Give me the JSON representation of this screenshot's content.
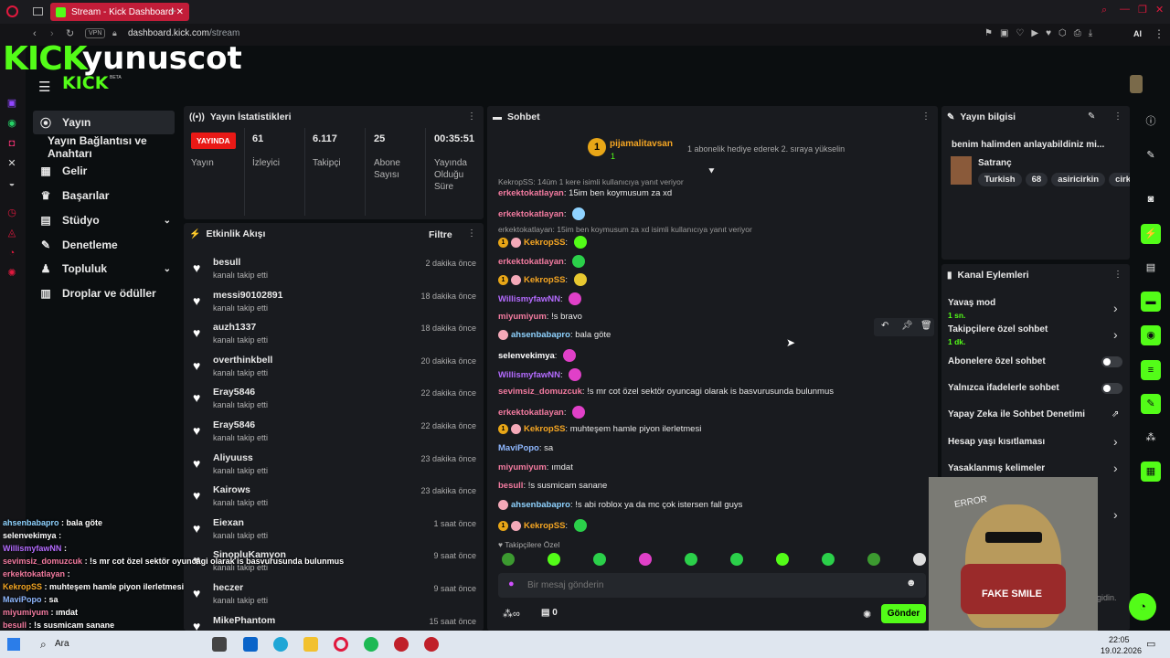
{
  "browser": {
    "tab_title": "Stream - Kick Dashboard",
    "url_domain": "dashboard.kick.com",
    "url_path": "/stream",
    "vpn": "VPN",
    "ai_label": "AI"
  },
  "brand": {
    "overlay_logo": "KICK",
    "overlay_name": "yunuscot",
    "logo": "KICK",
    "beta": "BETA"
  },
  "nav": {
    "items": [
      {
        "label": "Yayın",
        "icon": "broadcast-icon"
      },
      {
        "label": "Yayın Bağlantısı ve Anahtarı",
        "icon": ""
      },
      {
        "label": "Gelir",
        "icon": "chart-icon"
      },
      {
        "label": "Başarılar",
        "icon": "trophy-icon"
      },
      {
        "label": "Stüdyo",
        "icon": "studio-icon"
      },
      {
        "label": "Denetleme",
        "icon": "wrench-icon"
      },
      {
        "label": "Topluluk",
        "icon": "users-icon"
      },
      {
        "label": "Droplar ve ödüller",
        "icon": "gift-icon"
      }
    ]
  },
  "stats": {
    "title": "Yayın İstatistikleri",
    "live": "YAYINDA",
    "live_label": "Yayın",
    "viewers": "61",
    "viewers_label": "İzleyici",
    "followers": "6.117",
    "followers_label": "Takipçi",
    "subs": "25",
    "subs_label": "Abone Sayısı",
    "uptime": "00:35:51",
    "uptime_label": "Yayında Olduğu Süre"
  },
  "activity": {
    "title": "Etkinlik Akışı",
    "filter": "Filtre",
    "items": [
      {
        "user": "besull",
        "action": "kanalı takip etti",
        "time": "2 dakika önce"
      },
      {
        "user": "messi90102891",
        "action": "kanalı takip etti",
        "time": "18 dakika önce"
      },
      {
        "user": "auzh1337",
        "action": "kanalı takip etti",
        "time": "18 dakika önce"
      },
      {
        "user": "overthinkbell",
        "action": "kanalı takip etti",
        "time": "20 dakika önce"
      },
      {
        "user": "Eray5846",
        "action": "kanalı takip etti",
        "time": "22 dakika önce"
      },
      {
        "user": "Eray5846",
        "action": "kanalı takip etti",
        "time": "22 dakika önce"
      },
      {
        "user": "Aliyuuss",
        "action": "kanalı takip etti",
        "time": "23 dakika önce"
      },
      {
        "user": "Kairows",
        "action": "kanalı takip etti",
        "time": "23 dakika önce"
      },
      {
        "user": "Eiexan",
        "action": "kanalı takip etti",
        "time": "1 saat önce"
      },
      {
        "user": "SinopluKamyon",
        "action": "kanalı takip etti",
        "time": "9 saat önce"
      },
      {
        "user": "heczer",
        "action": "kanalı takip etti",
        "time": "9 saat önce"
      },
      {
        "user": "MikePhantom",
        "action": "",
        "time": "15 saat önce"
      }
    ]
  },
  "chat": {
    "title": "Sohbet",
    "pinned_user": "pijamalitavsan",
    "pinned_badge": "1",
    "pinned_count": "1",
    "pinned_text": "1 abonelik hediye ederek 2. sıraya yükselin",
    "reply1": "KekropSS: 14üm 1 kere isimli kullanıcıya yanıt veriyor",
    "reply2": "erkektokatlayan: 15im ben koymusum za xd isimli kullanıcıya yanıt veriyor",
    "messages": [
      {
        "user": "erkektokatlayan",
        "color": "#f37ba0",
        "text": "15im ben koymusum za xd"
      },
      {
        "user": "erkektokatlayan",
        "color": "#f37ba0",
        "text": ""
      },
      {
        "user": "KekropSS",
        "color": "#f5a623",
        "text": ""
      },
      {
        "user": "erkektokatlayan",
        "color": "#f37ba0",
        "text": ""
      },
      {
        "user": "KekropSS",
        "color": "#f5a623",
        "text": ""
      },
      {
        "user": "WillismyfawNN",
        "color": "#b46bff",
        "text": ""
      },
      {
        "user": "miyumiyum",
        "color": "#f37ba0",
        "text": "!s bravo"
      },
      {
        "user": "ahsenbabapro",
        "color": "#8fd3ff",
        "text": "bala göte"
      },
      {
        "user": "selenvekimya",
        "color": "#ffffff",
        "text": ""
      },
      {
        "user": "WillismyfawNN",
        "color": "#b46bff",
        "text": ""
      },
      {
        "user": "sevimsiz_domuzcuk",
        "color": "#f37ba0",
        "text": "!s mr cot özel sektör oyuncagi olarak is basvurusunda bulunmus"
      },
      {
        "user": "erkektokatlayan",
        "color": "#f37ba0",
        "text": ""
      },
      {
        "user": "KekropSS",
        "color": "#f5a623",
        "text": "muhteşem hamle piyon ilerletmesi"
      },
      {
        "user": "MaviPopo",
        "color": "#8fb8ff",
        "text": "sa"
      },
      {
        "user": "miyumiyum",
        "color": "#f37ba0",
        "text": "ımdat"
      },
      {
        "user": "besull",
        "color": "#f37ba0",
        "text": "!s susmicam sanane"
      },
      {
        "user": "ahsenbabapro",
        "color": "#8fd3ff",
        "text": "!s abi roblox ya da mc çok istersen fall guys"
      },
      {
        "user": "KekropSS",
        "color": "#f5a623",
        "text": ""
      }
    ],
    "followers_only": "Takipçilere Özel",
    "placeholder": "Bir mesaj gönderin",
    "send": "Gönder",
    "points": "0"
  },
  "stream_info": {
    "title": "Yayın bilgisi",
    "stream_title": "benim halimden anlayabildiniz mi...",
    "category": "Satranç",
    "tags": [
      "Turkish",
      "68",
      "asiricirkin",
      "cirk"
    ]
  },
  "channel_actions": {
    "title": "Kanal Eylemleri",
    "rows": [
      {
        "label": "Yavaş mod",
        "sub": "1 sn."
      },
      {
        "label": "Takipçilere özel sohbet",
        "sub": "1 dk."
      },
      {
        "label": "Abonelere özel sohbet",
        "sub": ""
      },
      {
        "label": "Yalnızca ifadelerle sohbet",
        "sub": ""
      },
      {
        "label": "Yapay Zeka ile Sohbet Denetimi",
        "sub": ""
      },
      {
        "label": "Hesap yaşı kısıtlaması",
        "sub": ""
      },
      {
        "label": "Yasaklanmış kelimeler",
        "sub": ""
      }
    ]
  },
  "overlay": {
    "meme_text": "FAKE SMILE",
    "meme_top": "ERROR",
    "partial": "gidin.",
    "lines": [
      {
        "user": "ahsenbabapro",
        "text": ": bala göte",
        "color": "#8fd3ff"
      },
      {
        "user": "selenvekimya",
        "text": ":",
        "color": "#ffffff"
      },
      {
        "user": "WillismyfawNN",
        "text": ":",
        "color": "#b46bff"
      },
      {
        "user": "sevimsiz_domuzcuk",
        "text": ": !s mr cot özel sektör oyuncagi olarak is basvurusunda bulunmus",
        "color": "#f37ba0"
      },
      {
        "user": "erkektokatlayan",
        "text": ":",
        "color": "#f37ba0"
      },
      {
        "user": "KekropSS",
        "text": ": muhteşem hamle piyon ilerletmesi",
        "color": "#f5a623"
      },
      {
        "user": "MaviPopo",
        "text": ": sa",
        "color": "#8fb8ff"
      },
      {
        "user": "miyumiyum",
        "text": ": ımdat",
        "color": "#f37ba0"
      },
      {
        "user": "besull",
        "text": ": !s susmicam sanane",
        "color": "#f37ba0"
      }
    ]
  },
  "taskbar": {
    "search": "Ara",
    "time": "22:05",
    "date": "19.02.2026"
  }
}
